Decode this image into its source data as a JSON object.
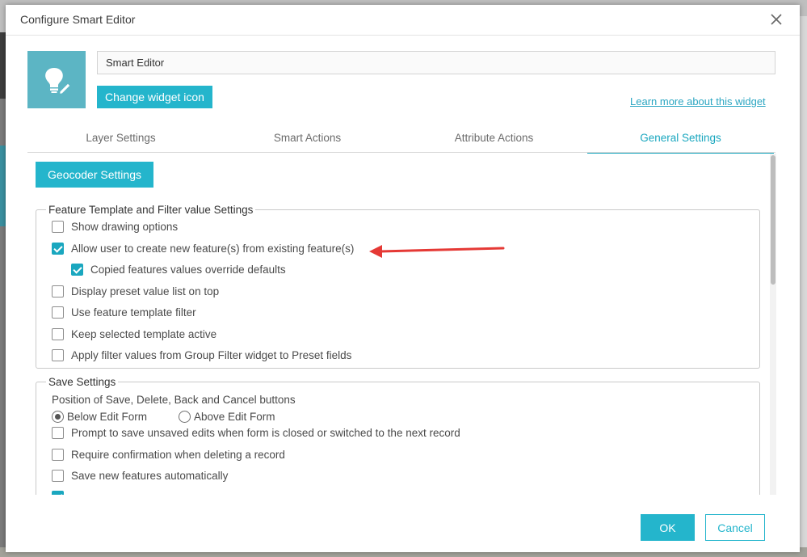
{
  "dialog": {
    "title": "Configure Smart Editor",
    "close_icon": "close-icon"
  },
  "widget": {
    "icon": "lightbulb-pencil-icon",
    "name_value": "Smart Editor",
    "change_icon_label": "Change widget icon",
    "learn_more_label": "Learn more about this widget"
  },
  "tabs": [
    {
      "label": "Layer Settings",
      "active": false
    },
    {
      "label": "Smart Actions",
      "active": false
    },
    {
      "label": "Attribute Actions",
      "active": false
    },
    {
      "label": "General Settings",
      "active": true
    }
  ],
  "general": {
    "geocoder_label": "Geocoder Settings",
    "feature_template": {
      "legend": "Feature Template and Filter value Settings",
      "options": [
        {
          "label": "Show drawing options",
          "checked": false
        },
        {
          "label": "Allow user to create new feature(s) from existing feature(s)",
          "checked": true
        },
        {
          "label": "Copied features values override defaults",
          "checked": true
        },
        {
          "label": "Display preset value list on top",
          "checked": false
        },
        {
          "label": "Use feature template filter",
          "checked": false
        },
        {
          "label": "Keep selected template active",
          "checked": false
        },
        {
          "label": "Apply filter values from Group Filter widget to Preset fields",
          "checked": false
        }
      ]
    },
    "save_settings": {
      "legend": "Save Settings",
      "position_label": "Position of Save, Delete, Back and Cancel buttons",
      "position_options": [
        {
          "label": "Below Edit Form",
          "selected": true
        },
        {
          "label": "Above Edit Form",
          "selected": false
        }
      ],
      "options": [
        {
          "label": "Prompt to save unsaved edits when form is closed or switched to the next record",
          "checked": false
        },
        {
          "label": "Require confirmation when deleting a record",
          "checked": false
        },
        {
          "label": "Save new features automatically",
          "checked": false
        }
      ]
    }
  },
  "footer": {
    "ok_label": "OK",
    "cancel_label": "Cancel"
  },
  "colors": {
    "accent": "#24b5cc",
    "annotation_arrow": "#e53935"
  }
}
